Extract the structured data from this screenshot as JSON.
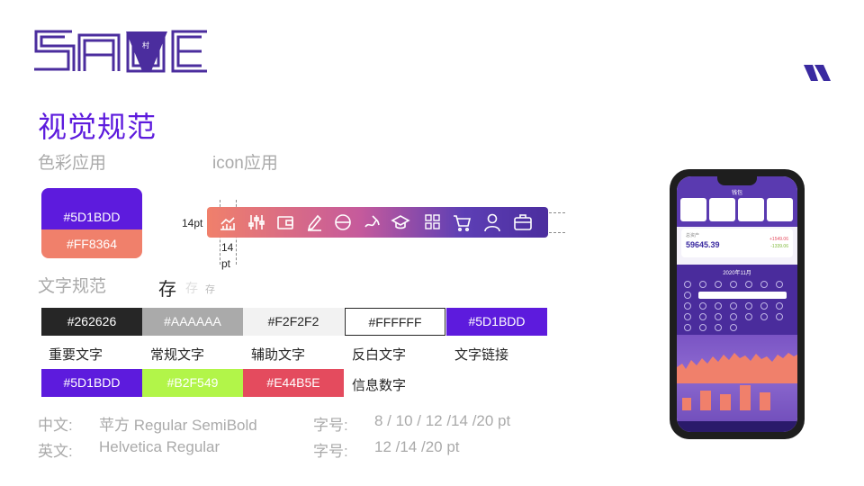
{
  "page": {
    "title": "视觉规范",
    "subtitle_color": "色彩应用",
    "subtitle_icon": "icon应用",
    "subtitle_text": "文字规范"
  },
  "colors": {
    "primary": "#5D1BDD",
    "accent": "#FF8364",
    "primary_label": "#5D1BDD",
    "accent_label": "#FF8364"
  },
  "icon_bar": {
    "icons": [
      "chart-icon",
      "sliders-icon",
      "wallet-icon",
      "pen-icon",
      "coin-icon",
      "writing-icon",
      "graduation-cap-icon",
      "apps-grid-icon",
      "cart-icon",
      "person-icon",
      "briefcase-icon"
    ],
    "height_label": "14pt",
    "width_label_line1": "14",
    "width_label_line2": "pt"
  },
  "type_sample": {
    "large": "存",
    "medium": "存",
    "small": "存"
  },
  "text_colors": [
    {
      "hex": "#262626",
      "label": "重要文字",
      "bg": "#262626",
      "fg": "#ffffff"
    },
    {
      "hex": "#AAAAAA",
      "label": "常规文字",
      "bg": "#AAAAAA",
      "fg": "#ffffff"
    },
    {
      "hex": "#F2F2F2",
      "label": "辅助文字",
      "bg": "#F2F2F2",
      "fg": "#262626"
    },
    {
      "hex": "#FFFFFF",
      "label": "反白文字",
      "bg": "#FFFFFF",
      "fg": "#262626"
    },
    {
      "hex": "#5D1BDD",
      "label": "文字链接",
      "bg": "#5D1BDD",
      "fg": "#ffffff"
    }
  ],
  "info_colors": {
    "chips": [
      {
        "hex": "#5D1BDD",
        "bg": "#5D1BDD"
      },
      {
        "hex": "#B2F549",
        "bg": "#B2F549"
      },
      {
        "hex": "#E44B5E",
        "bg": "#E44B5E"
      }
    ],
    "label": "信息数字"
  },
  "font_spec": {
    "cn_label": "中文:",
    "cn_font": "苹方 Regular SemiBold",
    "cn_size_label": "字号:",
    "cn_sizes": "8 / 10 / 12 /14 /20 pt",
    "en_label": "英文:",
    "en_font": "Helvetica Regular",
    "en_size_label": "字号:",
    "en_sizes": "12 /14 /20 pt"
  },
  "phone": {
    "app_title": "钱包",
    "asset_label": "总资产",
    "asset_value": "59645.39",
    "income": "+1549.06",
    "expense": "-1339.06",
    "month": "2020年11月"
  }
}
